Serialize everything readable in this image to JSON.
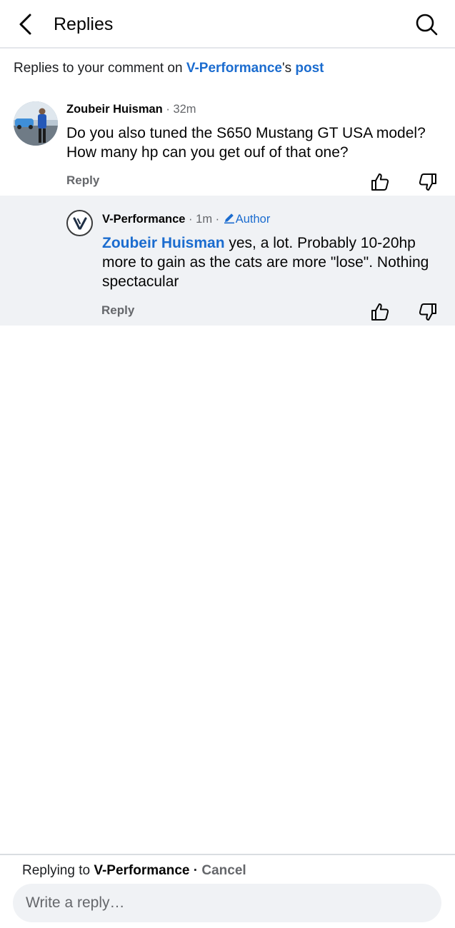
{
  "header": {
    "title": "Replies",
    "back_icon": "chevron-left-icon",
    "search_icon": "search-icon"
  },
  "context": {
    "prefix": "Replies to your comment on ",
    "page_name": "V-Performance",
    "possessive": "'s ",
    "post_link": "post"
  },
  "comments": [
    {
      "author": "Zoubeir Huisman",
      "time": "32m",
      "text": "Do you also tuned the S650 Mustang GT USA model? How many hp can you get ouf of that one?",
      "reply_label": "Reply",
      "avatar": "profile-photo"
    },
    {
      "author": "V-Performance",
      "time": "1m",
      "badge": "Author",
      "mention": "Zoubeir Huisman",
      "text": " yes, a lot. Probably 10-20hp more to gain as the cats are more \"lose\". Nothing spectacular",
      "reply_label": "Reply",
      "avatar": "page-logo"
    }
  ],
  "composer": {
    "replying_prefix": "Replying to ",
    "replying_name": "V-Performance",
    "separator": " · ",
    "cancel_label": "Cancel",
    "placeholder": "Write a reply…"
  },
  "colors": {
    "link": "#1b6ccf",
    "secondary_text": "#65676b",
    "highlight_bg": "#f0f2f5"
  }
}
